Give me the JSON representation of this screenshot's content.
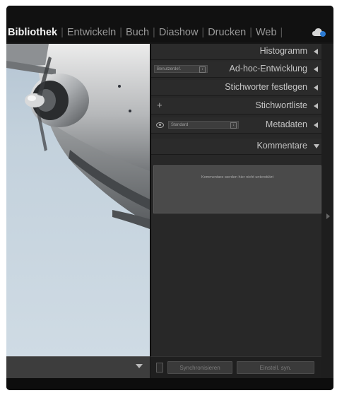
{
  "modules": [
    {
      "label": "Bibliothek",
      "active": true
    },
    {
      "label": "Entwickeln",
      "active": false
    },
    {
      "label": "Buch",
      "active": false
    },
    {
      "label": "Diashow",
      "active": false
    },
    {
      "label": "Drucken",
      "active": false
    },
    {
      "label": "Web",
      "active": false
    }
  ],
  "separator": "|",
  "panel": {
    "histogram": {
      "title": "Histogramm"
    },
    "quick_develop": {
      "title": "Ad-hoc-Entwicklung",
      "preset": "Benutzerdef."
    },
    "keywording": {
      "title": "Stichworter festlegen"
    },
    "keyword_list": {
      "title": "Stichwortliste",
      "add": "+"
    },
    "metadata": {
      "title": "Metadaten",
      "preset": "Standard"
    },
    "comments": {
      "title": "Kommentare",
      "message": "Kommentare werden hier nicht unterstützt"
    },
    "sync_button": "Synchronisieren",
    "defaults_button": "Einstell. syn."
  },
  "colors": {
    "background": "#161616",
    "panel": "#282828",
    "active_text": "#f2f2f2",
    "inactive_text": "#9a9a9a"
  },
  "icons": {
    "cloud": "cloud-sync-icon",
    "eye": "eye-icon",
    "filmstrip": "chevron-down-icon",
    "side": "chevron-right-icon"
  }
}
